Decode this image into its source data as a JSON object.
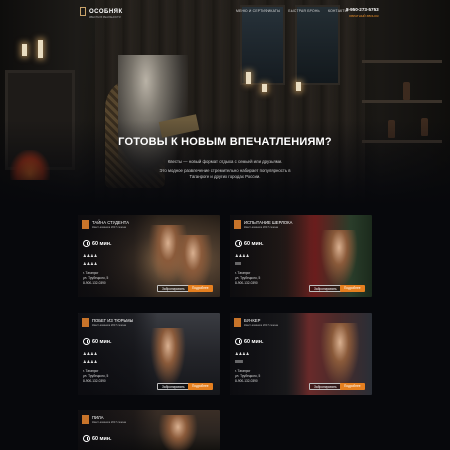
{
  "nav": {
    "logo": "ОСОБНЯК",
    "logo_sub": "КВЕСТЫ В РЕАЛЬНОСТИ",
    "links": [
      "МЕНЮ И СЕРТИФИКАТЫ",
      "БЫСТРАЯ БРОНЬ",
      "КОНТАКТЫ"
    ],
    "phone": "8-950-273-5753",
    "callback": "ОБРАТНЫЙ ЗВОНОК"
  },
  "hero": {
    "title": "ГОТОВЫ К НОВЫМ ВПЕЧАТЛЕНИЯМ?",
    "text1": "Квесты — новый формат отдыха с семьей или друзьями.",
    "text2": "Это модное развлечение стремительно набирает популярность в Таганроге и других городах России."
  },
  "cards": [
    {
      "title": "ТАЙНА СТУДЕНТА",
      "sub": "Квест-комната 2017 сезона",
      "time": "60 мин.",
      "people": "♟♟♟♟",
      "difficulty": "♟♟♟♟",
      "addr1": "г. Таганрог",
      "addr2": "ул. Трубецкого, 5",
      "addr3": "8-900-132-0390",
      "btn_details": "Подробнее",
      "btn_book": "Забронировать"
    },
    {
      "title": "ИСПЫТАНИЕ ШЕРЛОКА",
      "sub": "Квест-комната 2017 сезона",
      "time": "60 мин.",
      "people": "♟♟♟♟",
      "difficulty": "ⅡⅡⅡ",
      "addr1": "г. Таганрог",
      "addr2": "ул. Трубецкого, 5",
      "addr3": "8-900-132-0390",
      "btn_details": "Подробнее",
      "btn_book": "Забронировать"
    },
    {
      "title": "ПОБЕГ ИЗ ТЮРЬМЫ",
      "sub": "Квест-комната 2017 сезона",
      "time": "60 мин.",
      "people": "♟♟♟♟",
      "difficulty": "♟♟♟♟",
      "addr1": "г. Таганрог",
      "addr2": "ул. Трубецкого, 5",
      "addr3": "8-900-132-0390",
      "btn_details": "Подробнее",
      "btn_book": "Забронировать"
    },
    {
      "title": "БУНКЕР",
      "sub": "Квест-комната 2017 сезона",
      "time": "60 мин.",
      "people": "♟♟♟♟",
      "difficulty": "ⅡⅡⅡⅡ",
      "addr1": "г. Таганрог",
      "addr2": "ул. Трубецкого, 5",
      "addr3": "8-900-132-0390",
      "btn_details": "Подробнее",
      "btn_book": "Забронировать"
    },
    {
      "title": "ПИЛА",
      "sub": "Квест-комната 2017 сезона",
      "time": "60 мин."
    }
  ],
  "colors": {
    "accent": "#e57f1f",
    "background": "#07080c"
  }
}
